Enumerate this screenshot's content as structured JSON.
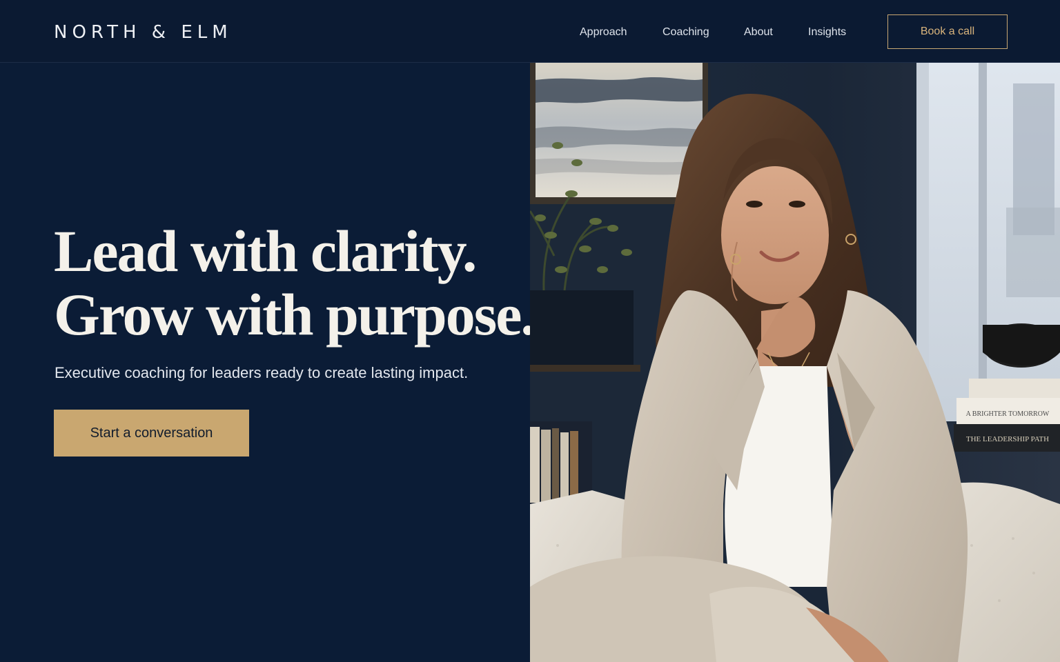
{
  "header": {
    "logo": "NORTH & ELM",
    "nav": [
      {
        "label": "Approach"
      },
      {
        "label": "Coaching"
      },
      {
        "label": "About"
      },
      {
        "label": "Insights"
      }
    ],
    "cta_label": "Book a call"
  },
  "hero": {
    "headline_line1": "Lead with clarity.",
    "headline_line2": "Grow with purpose.",
    "subheading": "Executive coaching for leaders ready to create lasting impact.",
    "cta_label": "Start a conversation",
    "photo": {
      "book_titles": [
        "A BRIGHTER TOMORROW",
        "THE LEADERSHIP PATH"
      ]
    }
  },
  "colors": {
    "navy": "#0b1c36",
    "gold": "#c9a770",
    "cream": "#f4f1ea"
  }
}
